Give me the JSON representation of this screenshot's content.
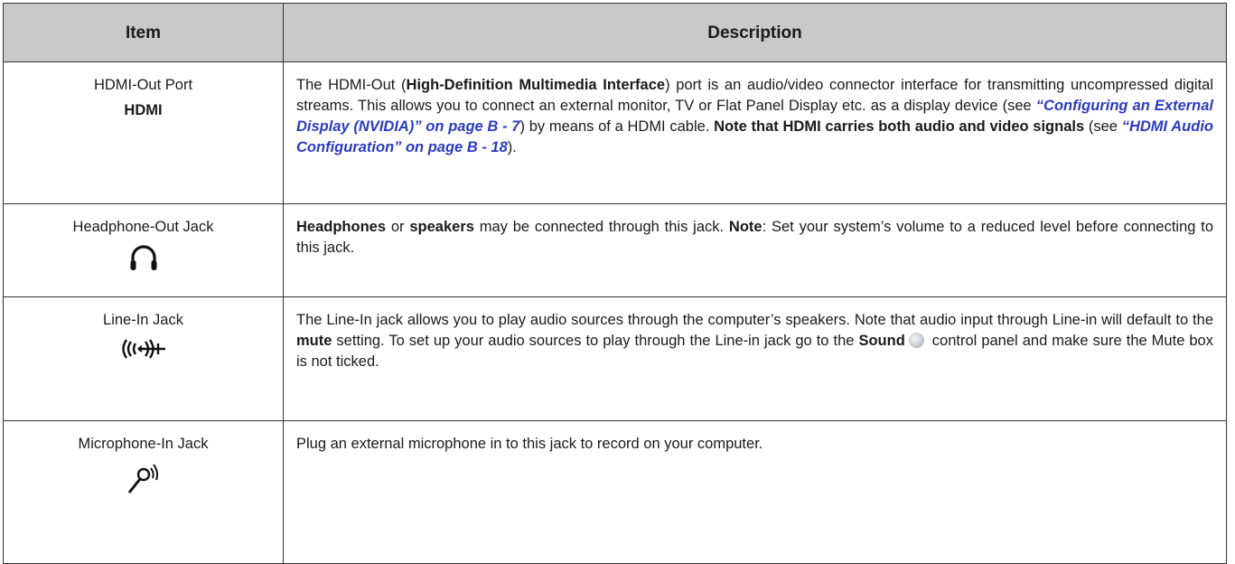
{
  "table": {
    "headers": {
      "item": "Item",
      "description": "Description"
    },
    "rows": [
      {
        "item_title": "HDMI-Out Port",
        "item_sub": "HDMI",
        "icon": "none",
        "desc": {
          "p1": "The HDMI-Out (",
          "b1": "High-Definition Multimedia Interface",
          "p2": ") port is an audio/video connector interface for transmitting uncompressed digital streams. This allows you to connect an external monitor, TV or Flat Panel Display etc. as a display device (see ",
          "link1": "“Configuring an External Display (NVIDIA)” on page B - 7",
          "p3": ") by means of a HDMI cable. ",
          "b2": "Note that HDMI carries both audio and video signals",
          "p4": " (see ",
          "link2": "“HDMI Audio Configuration” on page B - 18",
          "p5": ")."
        }
      },
      {
        "item_title": "Headphone-Out Jack",
        "icon": "headphone-icon",
        "desc": {
          "b1": "Headphones",
          "p1": " or ",
          "b2": "speakers",
          "p2": " may be connected through this jack. ",
          "b3": "Note",
          "p3": ": Set your system’s volume to a reduced level before connecting to this jack."
        }
      },
      {
        "item_title": "Line-In Jack",
        "icon": "line-in-icon",
        "desc": {
          "p1": "The Line-In jack allows you to play audio sources through the computer’s speakers. Note that audio input through Line-in will default to the ",
          "b1": "mute",
          "p2": " setting. To set up your audio sources to play through the Line-in jack go to the ",
          "b2": "Sound",
          "p3": " control panel and make sure the Mute box is not ticked."
        }
      },
      {
        "item_title": "Microphone-In Jack",
        "icon": "microphone-icon",
        "desc": {
          "p1": "Plug an external microphone in to this jack to record on your computer."
        }
      }
    ]
  },
  "colors": {
    "header_bg": "#c9c9c9",
    "link": "#2b3bbf",
    "border": "#333333"
  }
}
